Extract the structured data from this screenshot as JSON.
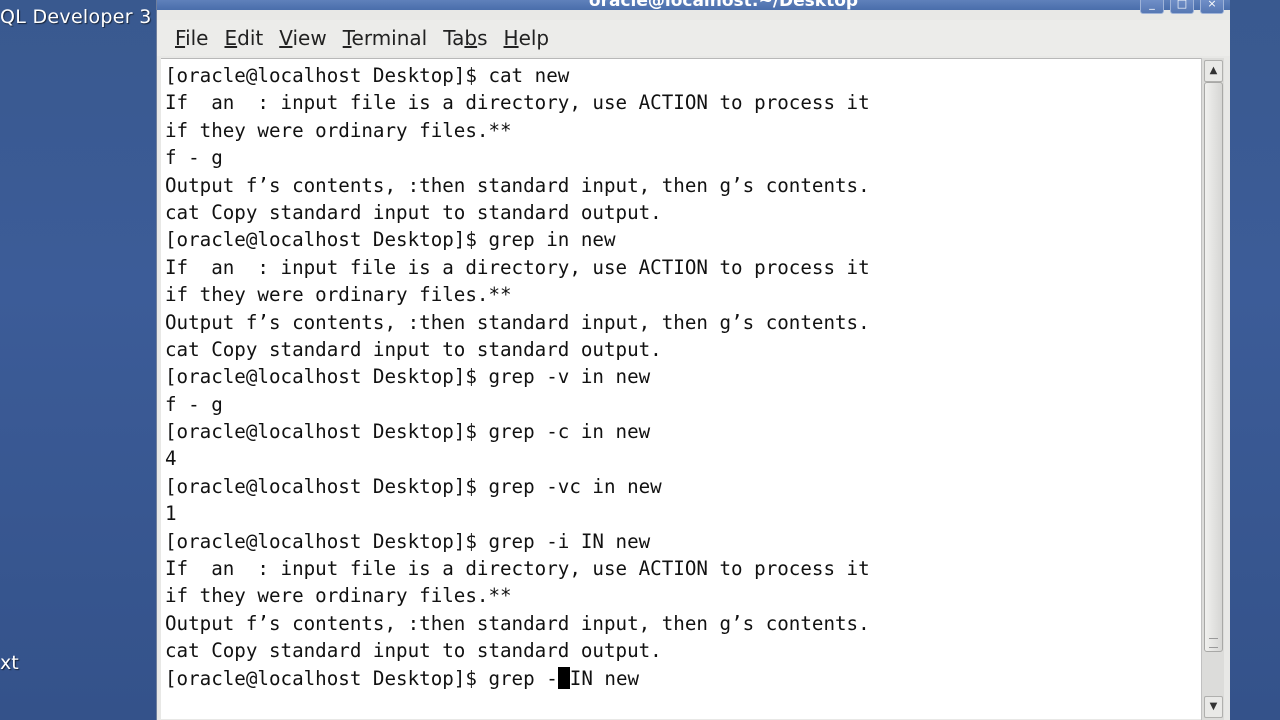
{
  "desktop": {
    "top_icon_label": "QL Developer 3",
    "left_icon_label": "xt"
  },
  "window": {
    "title": "oracle@localhost:~/Desktop",
    "buttons": [
      "_",
      "□",
      "×"
    ]
  },
  "menu": {
    "items": [
      {
        "pre": "",
        "mnemonic": "F",
        "post": "ile"
      },
      {
        "pre": "",
        "mnemonic": "E",
        "post": "dit"
      },
      {
        "pre": "",
        "mnemonic": "V",
        "post": "iew"
      },
      {
        "pre": "",
        "mnemonic": "T",
        "post": "erminal"
      },
      {
        "pre": "Ta",
        "mnemonic": "b",
        "post": "s"
      },
      {
        "pre": "",
        "mnemonic": "H",
        "post": "elp"
      }
    ]
  },
  "terminal": {
    "lines": [
      "[oracle@localhost Desktop]$ cat new",
      "If  an  : input file is a directory, use ACTION to process it",
      "if they were ordinary files.**",
      "f - g",
      "Output f’s contents, :then standard input, then g’s contents.",
      "cat Copy standard input to standard output.",
      "[oracle@localhost Desktop]$ grep in new",
      "If  an  : input file is a directory, use ACTION to process it",
      "if they were ordinary files.**",
      "Output f’s contents, :then standard input, then g’s contents.",
      "cat Copy standard input to standard output.",
      "[oracle@localhost Desktop]$ grep -v in new",
      "f - g",
      "[oracle@localhost Desktop]$ grep -c in new",
      "4",
      "[oracle@localhost Desktop]$ grep -vc in new",
      "1",
      "[oracle@localhost Desktop]$ grep -i IN new",
      "If  an  : input file is a directory, use ACTION to process it",
      "if they were ordinary files.**",
      "Output f’s contents, :then standard input, then g’s contents.",
      "cat Copy standard input to standard output."
    ],
    "prompt_before_cursor": "[oracle@localhost Desktop]$ grep -",
    "prompt_after_cursor": "IN new"
  }
}
